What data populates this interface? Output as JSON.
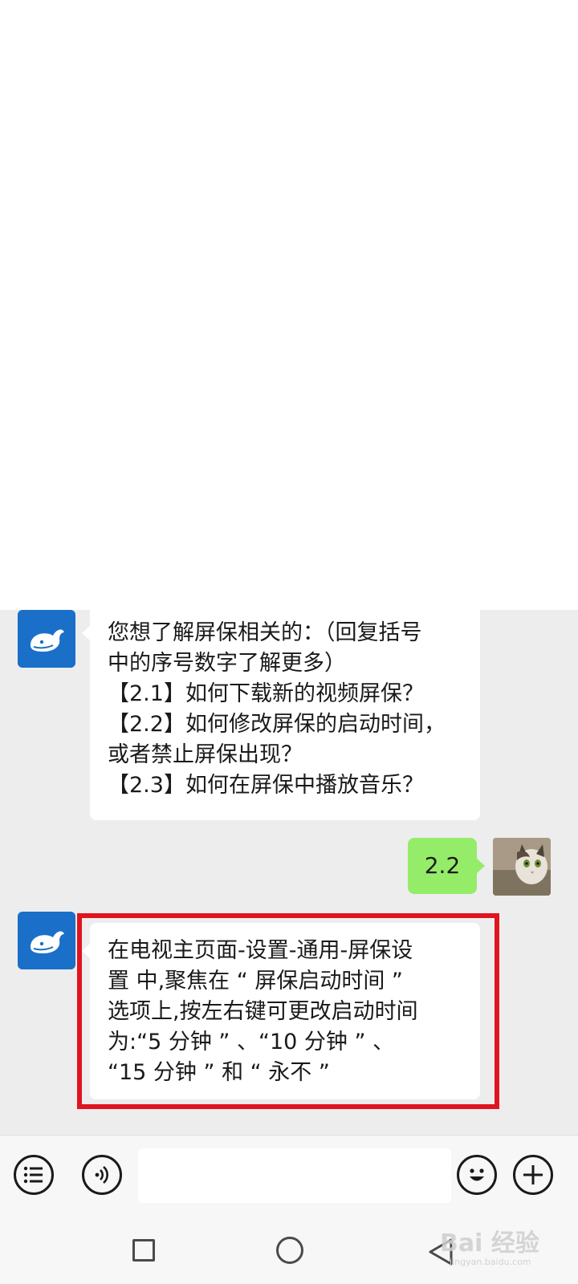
{
  "messages": [
    {
      "sender": "bot",
      "lines": [
        "您想了解屏保相关的：（回复括号",
        "中的序号数字了解更多）",
        "【2.1】如何下载新的视频屏保？",
        "【2.2】如何修改屏保的启动时间，",
        "或者禁止屏保出现？",
        "【2.3】如何在屏保中播放音乐？"
      ]
    },
    {
      "sender": "user",
      "text": "2.2"
    },
    {
      "sender": "bot",
      "lines": [
        "在电视主页面-设置-通用-屏保设",
        "置 中,聚焦在 “ 屏保启动时间 ”",
        "选项上,按左右键可更改启动时间",
        "为:“5 分钟 ” 、“10 分钟 ” 、",
        "“15 分钟 ” 和 “ 永不 ”"
      ]
    }
  ],
  "input_bar": {
    "menu_icon": "list-icon",
    "voice_icon": "voice-icon",
    "input_value": "",
    "emoji_icon": "emoji-icon",
    "plus_icon": "plus-icon"
  },
  "nav": {
    "recent_icon": "square-icon",
    "home_icon": "circle-icon",
    "back_icon": "back-triangle-icon"
  },
  "watermark": {
    "text": "Bai 经验",
    "sub": "jingyan.baidu.com"
  },
  "colors": {
    "chat_bg": "#ededed",
    "user_bubble": "#95ec69",
    "bot_avatar": "#1a6fc9",
    "highlight": "#e0141e"
  }
}
